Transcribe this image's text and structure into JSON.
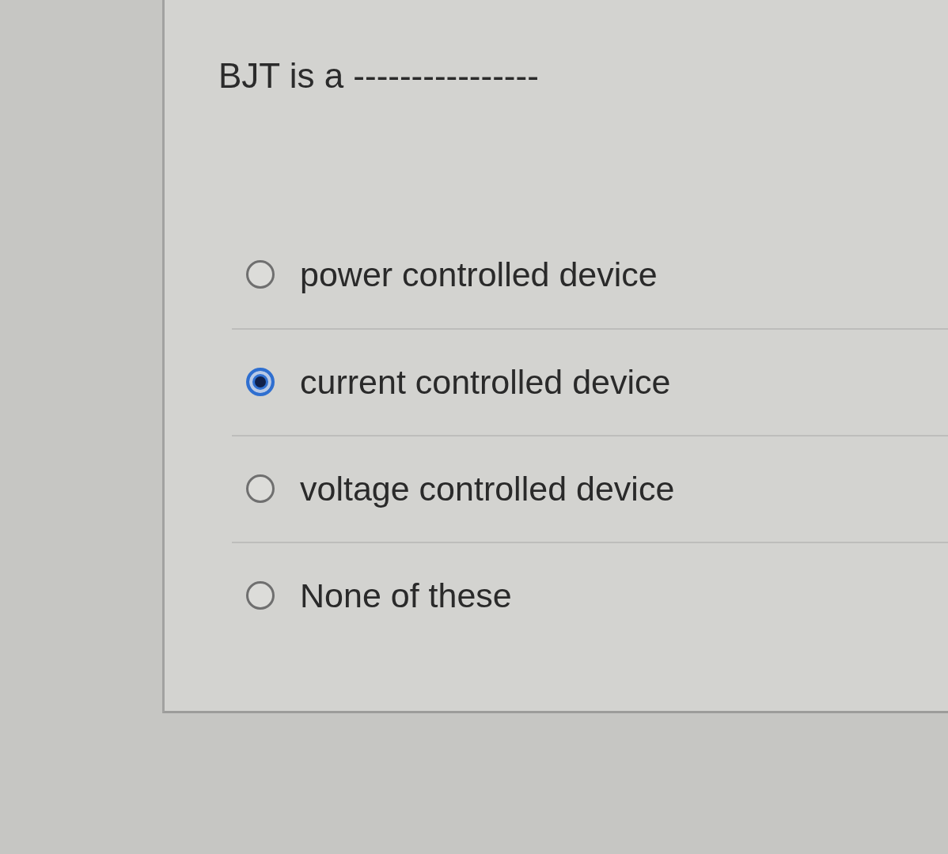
{
  "question": {
    "text": "BJT is a ----------------"
  },
  "options": [
    {
      "label": "power controlled device",
      "selected": false
    },
    {
      "label": "current controlled device",
      "selected": true
    },
    {
      "label": "voltage controlled device",
      "selected": false
    },
    {
      "label": "None of these",
      "selected": false
    }
  ]
}
